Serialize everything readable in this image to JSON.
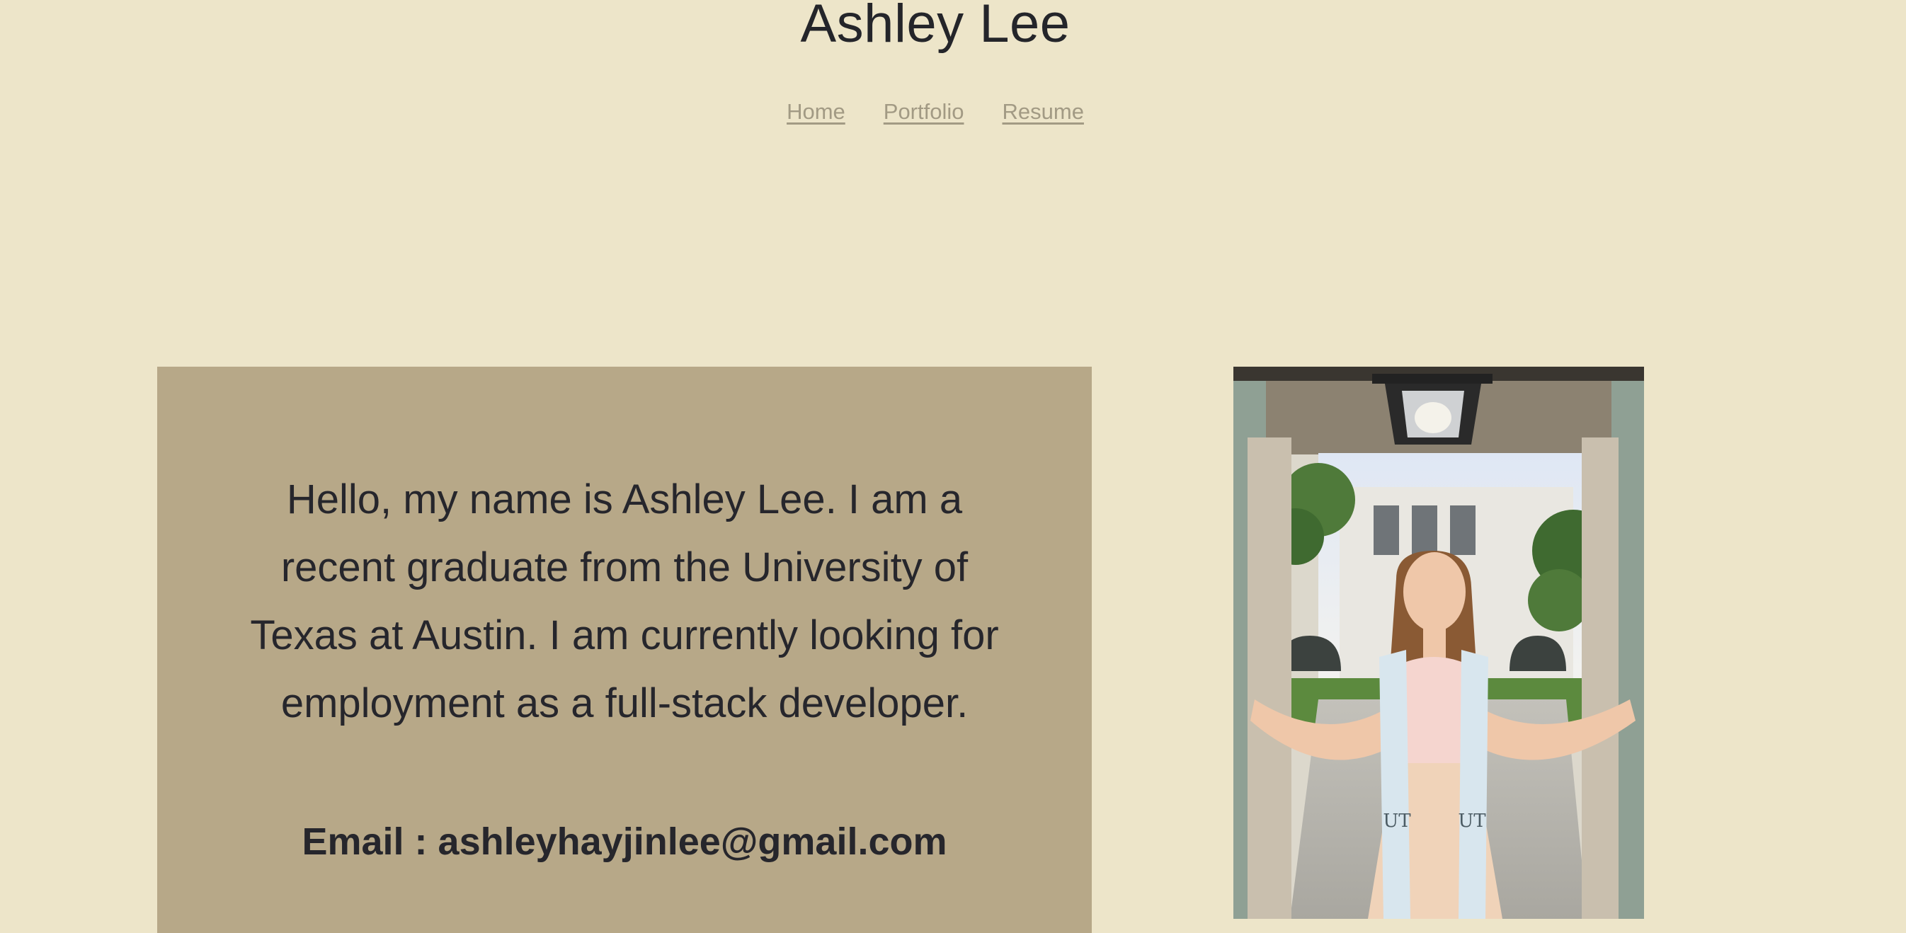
{
  "header": {
    "title": "Ashley Lee"
  },
  "nav": {
    "items": [
      {
        "label": "Home"
      },
      {
        "label": "Portfolio"
      },
      {
        "label": "Resume"
      }
    ]
  },
  "intro": {
    "text": "Hello, my name is Ashley Lee. I am a recent graduate from the University of Texas at Austin. I am currently looking for employment as a full-stack developer.",
    "email_label": "Email : ",
    "email": "ashleyhayjinlee@gmail.com"
  },
  "photo": {
    "stole_text_left": "UT",
    "stole_text_right": "UT"
  },
  "colors": {
    "background": "#ede5c9",
    "intro_box": "#b7a888",
    "nav_link": "#a29a84",
    "text": "#25252b"
  }
}
